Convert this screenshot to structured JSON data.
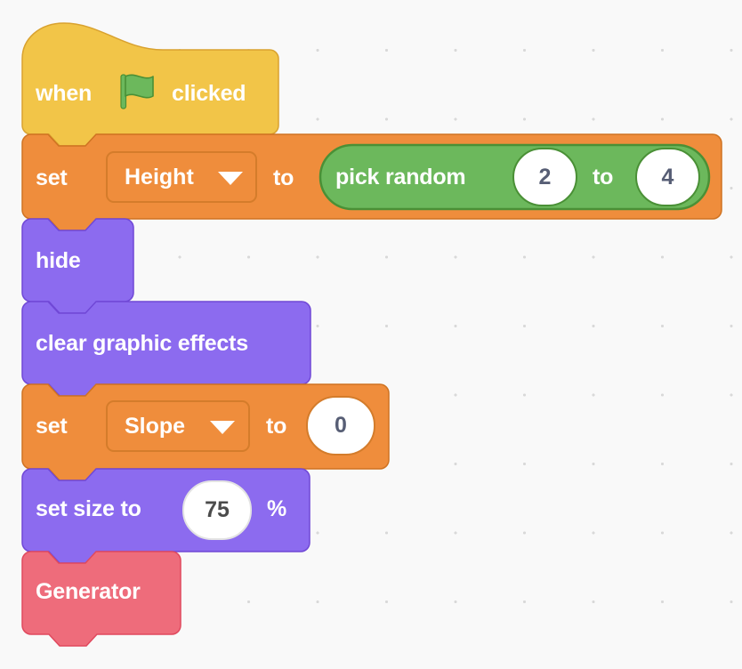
{
  "editor": {
    "background_color": "#F9F9F9",
    "grid_dot_color": "#D9D9D9"
  },
  "palette": {
    "events_yellow": "#FFBF00",
    "hat_fill": "#F2C548",
    "hat_stroke": "#D9A22F",
    "variables_orange": "#EF8D3C",
    "variables_orange_stroke": "#CF7322",
    "operators_green": "#6CB85C",
    "operators_green_stroke": "#4A9036",
    "looks_purple": "#8C6BEF",
    "looks_purple_stroke": "#7048D6",
    "custom_pink": "#EE6C7B",
    "custom_pink_stroke": "#E0495E",
    "input_white": "#FFFFFF",
    "input_text": "#575E75",
    "flag_green": "#6CB85C",
    "flag_green_stroke": "#4A9036"
  },
  "script": {
    "name": "green-flag-startup-script",
    "blocks": [
      {
        "id": "when-flag-clicked",
        "type": "hat",
        "category": "events",
        "text_before": "when",
        "icon": "green-flag-icon",
        "text_after": "clicked"
      },
      {
        "id": "set-height-to-pick-random",
        "type": "stack",
        "category": "variables",
        "label_set": "set",
        "variable": "Height",
        "label_to": "to",
        "dropdown_icon": "chevron-down-icon",
        "input": {
          "id": "pick-random-reporter",
          "type": "reporter",
          "category": "operators",
          "label_pick": "pick random",
          "from_value": "2",
          "label_to": "to",
          "to_value": "4"
        }
      },
      {
        "id": "hide",
        "type": "stack",
        "category": "looks",
        "label": "hide"
      },
      {
        "id": "clear-graphic-effects",
        "type": "stack",
        "category": "looks",
        "label": "clear graphic effects"
      },
      {
        "id": "set-slope-to-0",
        "type": "stack",
        "category": "variables",
        "label_set": "set",
        "variable": "Slope",
        "label_to": "to",
        "dropdown_icon": "chevron-down-icon",
        "value": "0"
      },
      {
        "id": "set-size-to-75",
        "type": "stack",
        "category": "looks",
        "label_prefix": "set size to",
        "value": "75",
        "label_suffix": "%"
      },
      {
        "id": "generator",
        "type": "stack",
        "category": "custom",
        "label": "Generator"
      }
    ]
  }
}
